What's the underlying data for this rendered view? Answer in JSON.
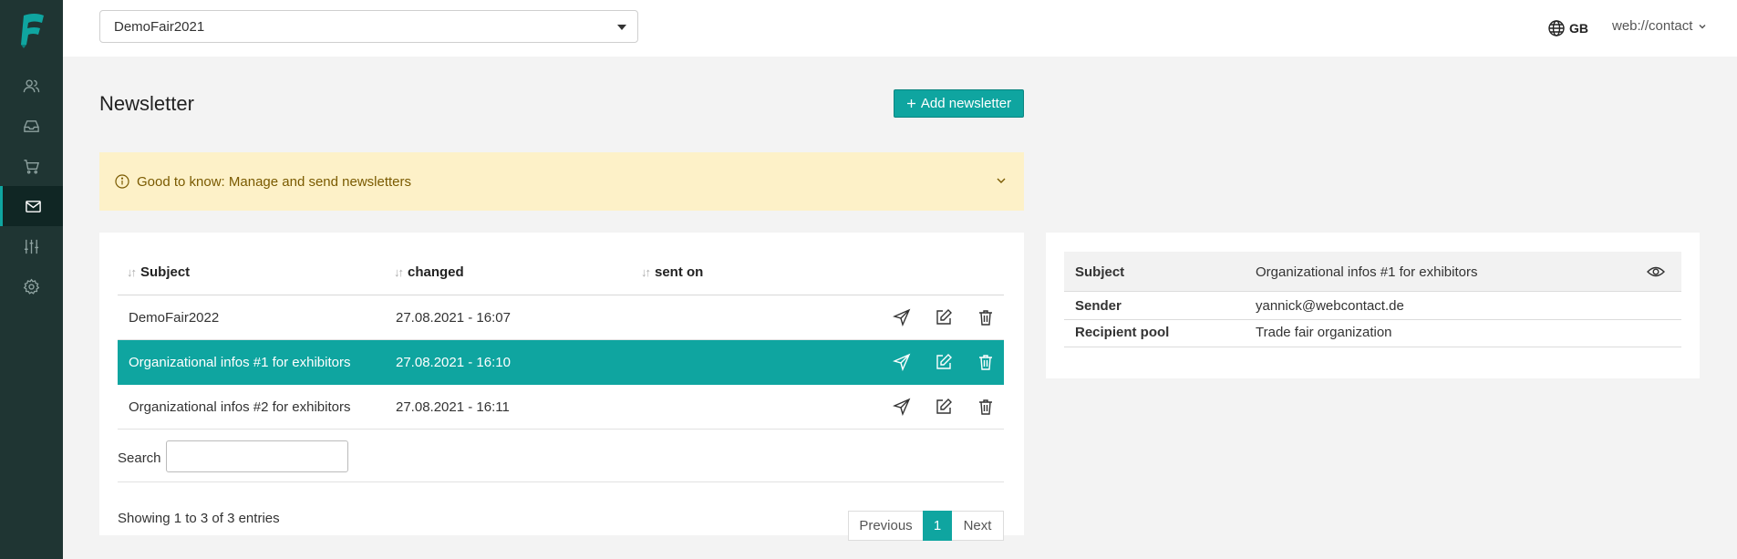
{
  "sidebar": {
    "logo": "webcontact-logo",
    "items": [
      {
        "icon": "users-icon",
        "active": false
      },
      {
        "icon": "inbox-icon",
        "active": false
      },
      {
        "icon": "cart-icon",
        "active": false
      },
      {
        "icon": "mail-icon",
        "active": true
      },
      {
        "icon": "sliders-icon",
        "active": false
      },
      {
        "icon": "gear-icon",
        "active": false
      }
    ]
  },
  "topbar": {
    "fair_select_value": "DemoFair2021",
    "language": "GB",
    "brand": "web://contact"
  },
  "page": {
    "title": "Newsletter",
    "add_button": "Add newsletter"
  },
  "info": {
    "text": "Good to know: Manage and send newsletters"
  },
  "table": {
    "columns": [
      "Subject",
      "changed",
      "sent on"
    ],
    "rows": [
      {
        "subject": "DemoFair2022",
        "changed": "27.08.2021 - 16:07",
        "sent_on": "",
        "selected": false
      },
      {
        "subject": "Organizational infos #1 for exhibitors",
        "changed": "27.08.2021 - 16:10",
        "sent_on": "",
        "selected": true
      },
      {
        "subject": "Organizational infos #2 for exhibitors",
        "changed": "27.08.2021 - 16:11",
        "sent_on": "",
        "selected": false
      }
    ],
    "search_label": "Search",
    "search_value": "",
    "showing": "Showing 1 to 3 of 3 entries",
    "pagination": {
      "previous": "Previous",
      "current": "1",
      "next": "Next"
    }
  },
  "details": {
    "rows": [
      {
        "label": "Subject",
        "value": "Organizational infos #1 for exhibitors"
      },
      {
        "label": "Sender",
        "value": "yannick@webcontact.de"
      },
      {
        "label": "Recipient pool",
        "value": "Trade fair organization"
      }
    ]
  },
  "colors": {
    "accent": "#0fa5a0",
    "sidebar": "#1f3533",
    "info_bg": "#fdf1c8",
    "info_text": "#7a5a00"
  }
}
